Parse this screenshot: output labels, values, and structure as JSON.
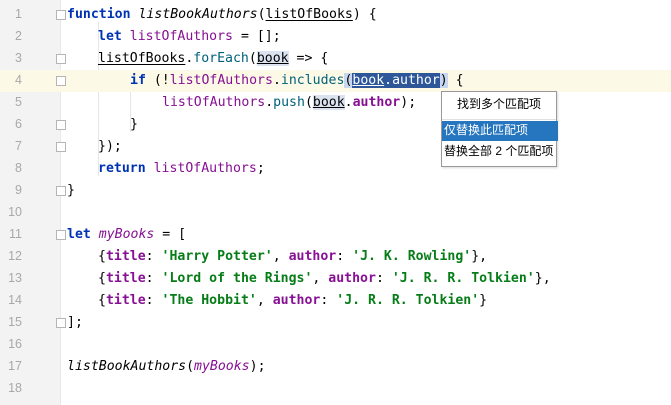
{
  "editor": {
    "line_numbers": [
      "1",
      "2",
      "3",
      "4",
      "5",
      "6",
      "7",
      "8",
      "9",
      "10",
      "11",
      "12",
      "13",
      "14",
      "15",
      "16",
      "17",
      "18"
    ],
    "code": {
      "l1": {
        "kw": "function",
        "sp": " ",
        "name": "listBookAuthors",
        "open": "(",
        "param": "listOfBooks",
        "close": ") {"
      },
      "l2": {
        "kw": "let",
        "sp": " ",
        "var": "listOfAuthors",
        "rest": " = [];"
      },
      "l3": {
        "obj": "listOfBooks",
        "dot": ".",
        "method": "forEach",
        "open": "(",
        "param": "book",
        "rest": " => {"
      },
      "l4": {
        "kw": "if",
        "open": " (!",
        "var": "listOfAuthors",
        "dot": ".",
        "method": "includes",
        "paren": "(",
        "sel_obj": "book",
        "sel_dot": ".",
        "sel_prop": "author",
        "close_paren": ")",
        "rest": " {"
      },
      "l5": {
        "var": "listOfAuthors",
        "dot": ".",
        "method": "push",
        "open": "(",
        "obj": "book",
        "dot2": ".",
        "prop": "author",
        "rest": ");"
      },
      "l6": {
        "text": "}"
      },
      "l7": {
        "text": "});"
      },
      "l8": {
        "kw": "return",
        "sp": " ",
        "var": "listOfAuthors",
        "rest": ";"
      },
      "l9": {
        "text": "}"
      },
      "l11": {
        "kw": "let",
        "sp": " ",
        "var": "myBooks",
        "rest": " = ["
      },
      "l12": {
        "open": "{",
        "k1": "title",
        "c1": ": ",
        "v1": "'Harry Potter'",
        "sep": ", ",
        "k2": "author",
        "c2": ": ",
        "v2": "'J. K. Rowling'",
        "close": "},"
      },
      "l13": {
        "open": "{",
        "k1": "title",
        "c1": ": ",
        "v1": "'Lord of the Rings'",
        "sep": ", ",
        "k2": "author",
        "c2": ": ",
        "v2": "'J. R. R. Tolkien'",
        "close": "},"
      },
      "l14": {
        "open": "{",
        "k1": "title",
        "c1": ": ",
        "v1": "'The Hobbit'",
        "sep": ", ",
        "k2": "author",
        "c2": ": ",
        "v2": "'J. R. R. Tolkien'",
        "close": "}"
      },
      "l15": {
        "text": "];"
      },
      "l17": {
        "fn": "listBookAuthors",
        "open": "(",
        "arg": "myBooks",
        "close": ");"
      }
    }
  },
  "popup": {
    "title": "找到多个匹配项",
    "items": [
      "仅替换此匹配项",
      "替换全部 2 个匹配项"
    ]
  },
  "colors": {
    "keyword": "#0033b3",
    "variable": "#871094",
    "string": "#067d17",
    "method": "#00627a",
    "selection": "#2d5799",
    "popup_selected": "#2675bf",
    "current_line": "#fcfae6"
  }
}
